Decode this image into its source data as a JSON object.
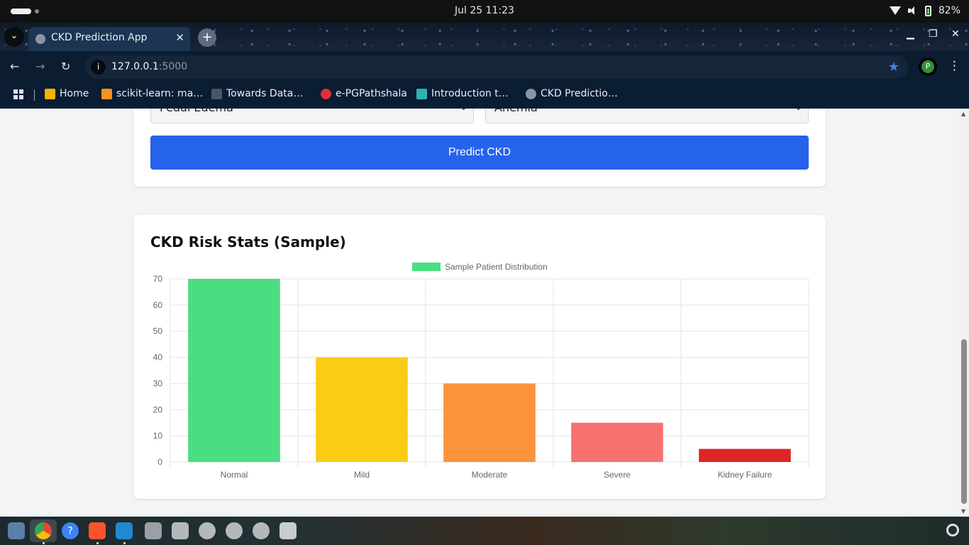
{
  "os": {
    "clock": "Jul 25  11:23",
    "battery": "82%"
  },
  "browser": {
    "tab_title": "CKD Prediction App",
    "tab_close": "✕",
    "new_tab": "+",
    "url_host": "127.0.0.1",
    "url_port": ":5000",
    "profile_initial": "P",
    "bookmarks": [
      {
        "label": "Home",
        "color": "#f4b400"
      },
      {
        "label": "scikit-learn: ma…",
        "color": "#f7931e"
      },
      {
        "label": "Towards Data…",
        "color": "#4a5566"
      },
      {
        "label": "e-PGPathshala",
        "color": "#e03131"
      },
      {
        "label": "Introduction t…",
        "color": "#2bb3b1"
      },
      {
        "label": "CKD Predictio…",
        "color": "#8a96a4"
      }
    ]
  },
  "form": {
    "select_left": "Pedal Edema",
    "select_right": "Anemia",
    "predict_button": "Predict CKD"
  },
  "stats": {
    "heading": "CKD Risk Stats (Sample)"
  },
  "chart_data": {
    "type": "bar",
    "title": "",
    "legend": [
      "Sample Patient Distribution"
    ],
    "legend_position": "top",
    "categories": [
      "Normal",
      "Mild",
      "Moderate",
      "Severe",
      "Kidney Failure"
    ],
    "series": [
      {
        "name": "Sample Patient Distribution",
        "values": [
          70,
          40,
          30,
          15,
          5
        ]
      }
    ],
    "colors": [
      "#4ade80",
      "#facc15",
      "#fb923c",
      "#f87171",
      "#dc2626"
    ],
    "legend_color": "#4ade80",
    "ylim": [
      0,
      70
    ],
    "yticks": [
      "0",
      "10",
      "20",
      "30",
      "40",
      "50",
      "60",
      "70"
    ],
    "grid": true,
    "xlabel": "",
    "ylabel": ""
  },
  "taskbar": {
    "apps": [
      "files-icon",
      "chrome-icon",
      "help-icon",
      "brave-icon",
      "vscode-icon",
      "settings-icon",
      "disk-icon",
      "disk-icon",
      "disk-icon",
      "disk-icon",
      "trash-icon"
    ]
  }
}
